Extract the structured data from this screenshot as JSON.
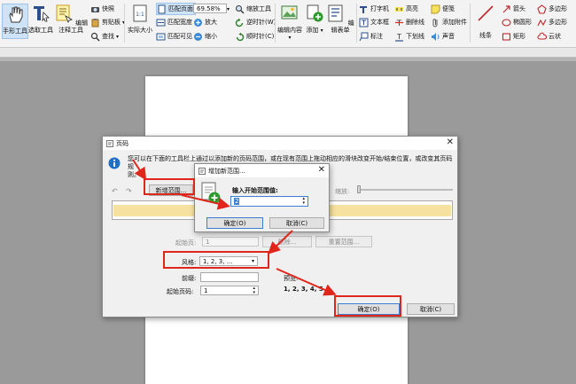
{
  "ribbon": {
    "hand_tool": "手形工具",
    "select_tool": "选取工具",
    "edit_annot_tool": "编辑注释工具",
    "snapshot": "快照",
    "clipboard": "剪贴板",
    "find": "查找",
    "actual_size": "实际大小",
    "fit_page": "匹配页面",
    "fit_width": "匹配宽度",
    "fit_visible": "匹配可见",
    "zoom_value": "69.58%",
    "zoom_in": "放大",
    "zoom_out": "缩小",
    "zoom_tool": "缩放工具",
    "rotate_ccw": "逆时针(W)",
    "rotate_cw": "顺时针(C)",
    "edit_content": "编辑内容",
    "add": "添加",
    "edit_form": "编辑表单",
    "typewriter": "打字机",
    "textbox": "文本框",
    "note_callout": "标注",
    "highlight": "高亮",
    "strikeout": "删除线",
    "underline": "下划线",
    "sticky_note": "便笺",
    "attach_file": "添加附件",
    "sound": "声音",
    "line": "线条",
    "arrow": "箭头",
    "ellipse": "椭圆形",
    "rectangle": "矩形",
    "polygon": "多边形",
    "polyline": "多边形",
    "cloud": "云状"
  },
  "main_dialog": {
    "title": "页码",
    "info_line1": "您可以在下面的工具栏上通过以添加新的页码范围，或在现有范围上拖动相应的滑块改变开始/结束位置，或改变其页码规",
    "info_line2": "则。",
    "new_range_button": "新增范围...",
    "zoom_label": "缩放:",
    "start_page_label": "起始页:",
    "start_page_value": "1",
    "delete_button": "删除...",
    "reset_button": "重置范围...",
    "style_label": "风格:",
    "style_value": "1, 2, 3, ...",
    "prefix_label": "前缀:",
    "prefix_value": "",
    "start_number_label": "起始页码:",
    "start_number_value": "1",
    "preview_label": "预览:",
    "preview_value": "1, 2, 3, 4, 5",
    "ok_button": "确定(O)",
    "cancel_button": "取消(C)"
  },
  "sub_dialog": {
    "title": "增加新范围...",
    "prompt": "输入开始范围值:",
    "value": "2",
    "ok_button": "确定(O)",
    "cancel_button": "取消(C)"
  },
  "colors": {
    "range_bar": "#f7e1a0",
    "highlight_red": "#e0251b",
    "accent_blue": "#1f6fc7"
  }
}
